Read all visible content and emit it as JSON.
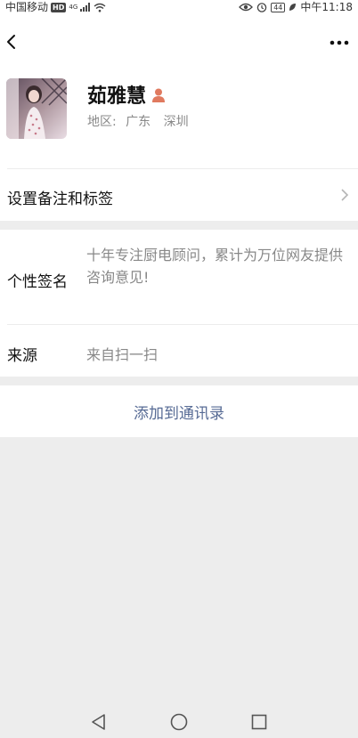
{
  "status_bar": {
    "carrier": "中国移动",
    "hd": "HD",
    "network": "4G",
    "battery": "44",
    "time": "中午11:18"
  },
  "nav": {
    "back_icon": "chevron-left-icon",
    "more_icon": "more-dots-icon"
  },
  "profile": {
    "name": "茹雅慧",
    "gender_icon": "female-user-icon",
    "region_label": "地区:",
    "region_province": "广东",
    "region_city": "深圳"
  },
  "rows": {
    "remark_label": "设置备注和标签",
    "signature_label": "个性签名",
    "signature_text": "十年专注厨电顾问，累计为万位网友提供咨询意见!",
    "source_label": "来源",
    "source_text": "来自扫一扫"
  },
  "actions": {
    "add_contact": "添加到通讯录"
  },
  "colors": {
    "link": "#576b95",
    "gap": "#ededed",
    "secondary_text": "#888888",
    "gender_icon": "#e07a5f"
  }
}
